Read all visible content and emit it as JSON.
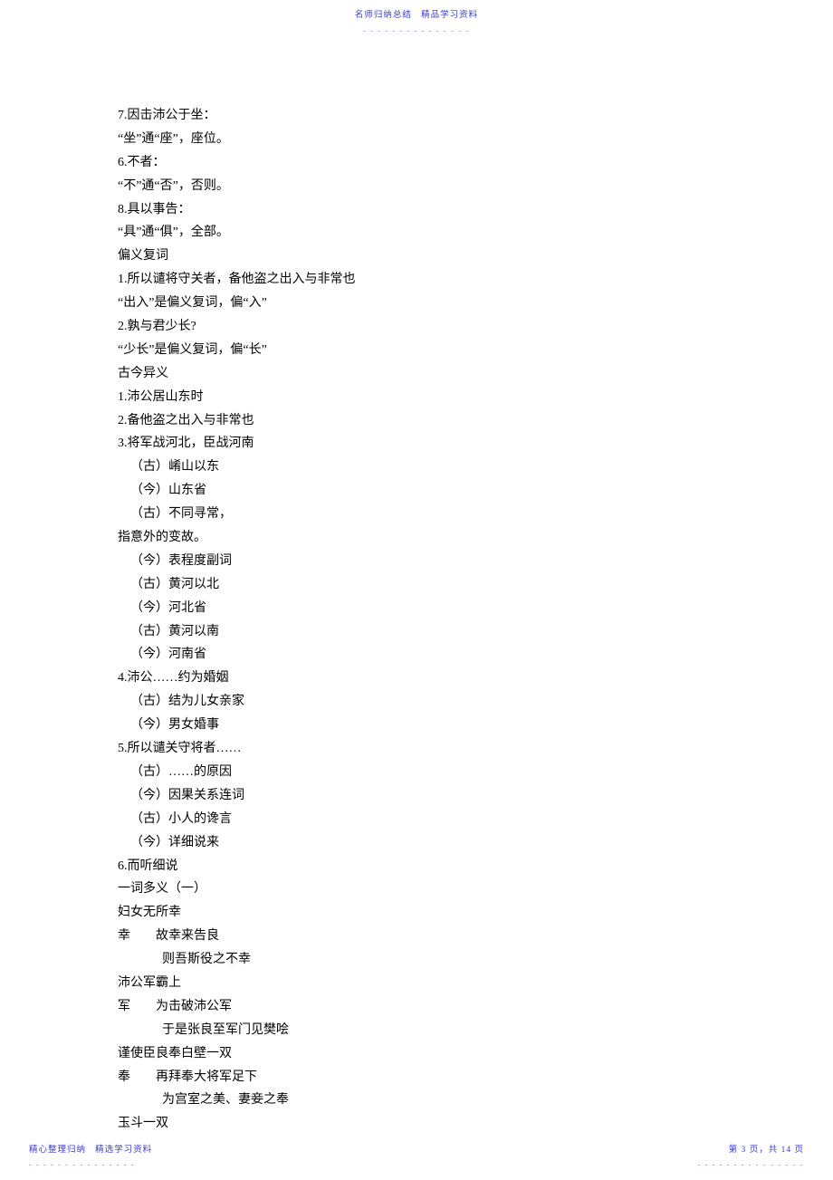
{
  "header": {
    "left": "名师归纳总结",
    "right": "精品学习资料",
    "dashes": "- - - - - - - - - - - - - - -"
  },
  "lines": [
    {
      "text": "7.因击沛公于坐：",
      "cls": ""
    },
    {
      "text": "“坐”通“座”，座位。",
      "cls": ""
    },
    {
      "text": "6.不者：",
      "cls": ""
    },
    {
      "text": "“不”通“否”，否则。",
      "cls": ""
    },
    {
      "text": "8.具以事告：",
      "cls": ""
    },
    {
      "text": "“具”通“俱”，全部。",
      "cls": ""
    },
    {
      "text": "偏义复词",
      "cls": ""
    },
    {
      "text": "1.所以谴将守关者，备他盗之出入与非常也",
      "cls": ""
    },
    {
      "text": "“出入”是偏义复词，偏“入”",
      "cls": ""
    },
    {
      "text": "2.孰与君少长?",
      "cls": ""
    },
    {
      "text": "“少长”是偏义复词，偏“长”",
      "cls": ""
    },
    {
      "text": "古今异义",
      "cls": ""
    },
    {
      "text": "1.沛公居山东时",
      "cls": ""
    },
    {
      "text": "2.备他盗之出入与非常也",
      "cls": ""
    },
    {
      "text": "3.将军战河北，臣战河南",
      "cls": ""
    },
    {
      "text": "（古）崤山以东",
      "cls": "indent1"
    },
    {
      "text": "（今）山东省",
      "cls": "indent1"
    },
    {
      "text": "（古）不同寻常，",
      "cls": "indent1"
    },
    {
      "text": "指意外的变故。",
      "cls": ""
    },
    {
      "text": "（今）表程度副词",
      "cls": "indent1"
    },
    {
      "text": "（古）黄河以北",
      "cls": "indent1"
    },
    {
      "text": "（今）河北省",
      "cls": "indent1"
    },
    {
      "text": "（古）黄河以南",
      "cls": "indent1"
    },
    {
      "text": "（今）河南省",
      "cls": "indent1"
    },
    {
      "text": "4.沛公……约为婚姻",
      "cls": ""
    },
    {
      "text": "（古）结为儿女亲家",
      "cls": "indent1"
    },
    {
      "text": "（今）男女婚事",
      "cls": "indent1"
    },
    {
      "text": "5.所以谴关守将者……",
      "cls": ""
    },
    {
      "text": "（古）……的原因",
      "cls": "indent1"
    },
    {
      "text": "（今）因果关系连词",
      "cls": "indent1"
    },
    {
      "text": "（古）小人的谗言",
      "cls": "indent1"
    },
    {
      "text": "（今）详细说来",
      "cls": "indent1"
    },
    {
      "text": "6.而听细说",
      "cls": ""
    },
    {
      "text": "一词多义（一）",
      "cls": ""
    },
    {
      "text": "妇女无所幸",
      "cls": ""
    },
    {
      "text": "幸|故幸来告良",
      "cls": "",
      "gapAfterFirst": true
    },
    {
      "text": "则吾斯役之不幸",
      "cls": "indent4"
    },
    {
      "text": "沛公军霸上",
      "cls": ""
    },
    {
      "text": "军|为击破沛公军",
      "cls": "",
      "gapAfterFirst": true
    },
    {
      "text": "于是张良至军门见樊哙",
      "cls": "indent4"
    },
    {
      "text": "谨使臣良奉白壁一双",
      "cls": ""
    },
    {
      "text": "奉|再拜奉大将军足下",
      "cls": "",
      "gapAfterFirst": true
    },
    {
      "text": "为宫室之美、妻妾之奉",
      "cls": "indent4"
    },
    {
      "text": "玉斗一双",
      "cls": ""
    }
  ],
  "footer": {
    "leftA": "精心整理归纳",
    "leftB": "精选学习资料",
    "right": "第 3 页，共 14 页",
    "dashes": "- - - - - - - - - - - - - - -"
  }
}
